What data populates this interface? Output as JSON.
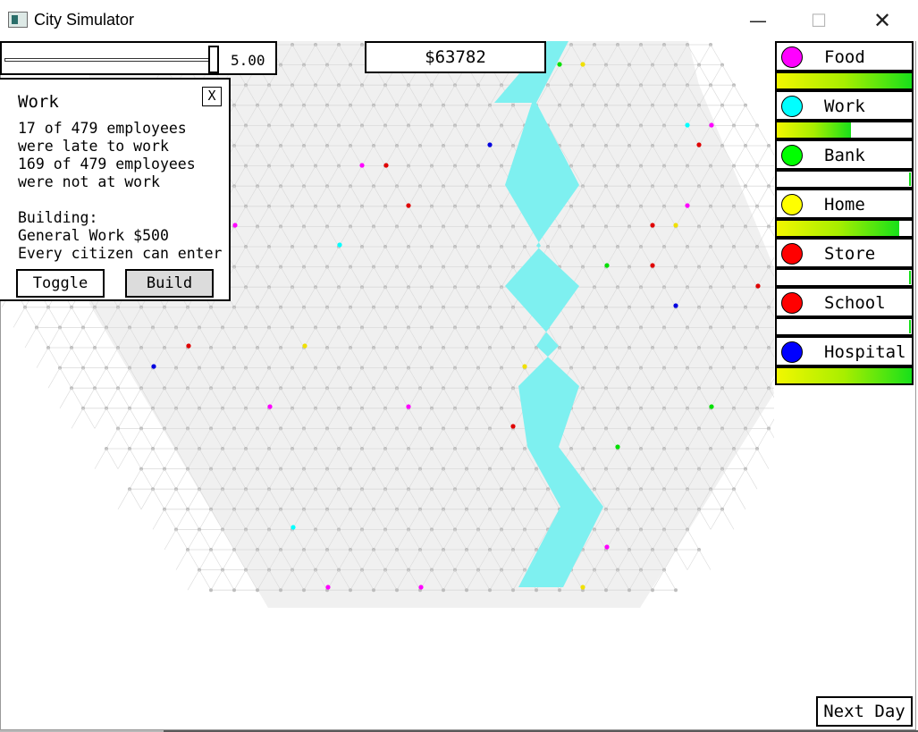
{
  "window": {
    "title": "City Simulator",
    "minimize_glyph": "—",
    "maximize_glyph": "☐",
    "close_glyph": "✕",
    "icon": "app-window-icon"
  },
  "speed_slider": {
    "value": 0.96,
    "value_label": "5.00"
  },
  "money": "$63782",
  "info_panel": {
    "title": "Work",
    "close_label": "X",
    "lines": [
      "17 of 479 employees",
      "were late to work",
      "169 of 479 employees",
      "were not at work",
      "",
      "Building:",
      "General Work $500",
      "Every citizen can enter"
    ],
    "toggle_label": "Toggle",
    "build_label": "Build"
  },
  "legend": [
    {
      "label": "Food",
      "color": "#ff00ff",
      "fill": 1.0
    },
    {
      "label": "Work",
      "color": "#00ffff",
      "fill": 0.55
    },
    {
      "label": "Bank",
      "color": "#00ff00",
      "fill": 0.0
    },
    {
      "label": "Home",
      "color": "#ffff00",
      "fill": 0.91
    },
    {
      "label": "Store",
      "color": "#ff0000",
      "fill": 0.0
    },
    {
      "label": "School",
      "color": "#ff0000",
      "fill": 0.0
    },
    {
      "label": "Hospital",
      "color": "#0000ff",
      "fill": 1.0
    }
  ],
  "next_day_label": "Next Day",
  "colors": {
    "river": "#7ef0f0",
    "grid_dot": "#bdbdbd",
    "grid_line": "#dadada",
    "map_bg": "#f0f0f0",
    "food": "#ff00ff",
    "work": "#00ffff",
    "bank": "#00e000",
    "home": "#f0e000",
    "store": "#e00000",
    "hospital": "#0000e0"
  }
}
